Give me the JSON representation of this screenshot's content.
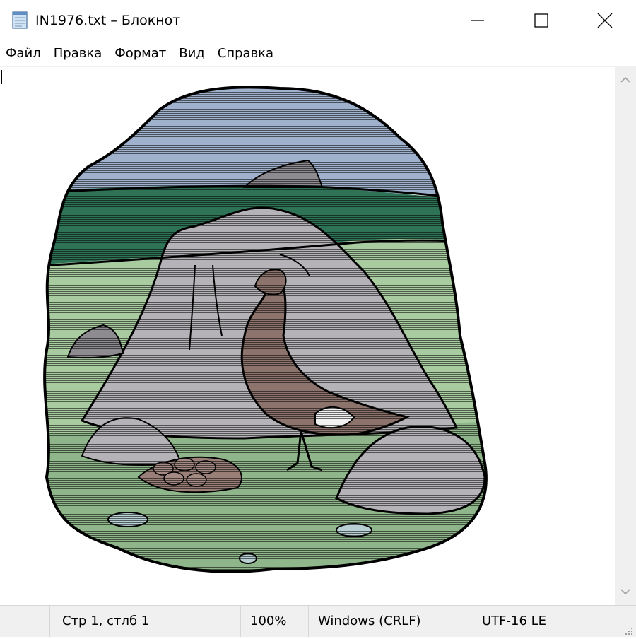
{
  "window": {
    "title": "IN1976.txt – Блокнот",
    "controls": {
      "minimize": "minimize-icon",
      "maximize": "maximize-icon",
      "close": "close-icon"
    }
  },
  "menu": {
    "items": [
      "Файл",
      "Правка",
      "Формат",
      "Вид",
      "Справка"
    ]
  },
  "editor": {
    "content": "ASCII-art illustration: a grouse beside a large boulder with a nest of eggs",
    "scrollbar": {
      "up": "chevron-up-icon",
      "down": "chevron-down-icon"
    }
  },
  "status": {
    "position": "Стр 1, стлб 1",
    "zoom": "100%",
    "line_endings": "Windows (CRLF)",
    "encoding": "UTF-16 LE"
  },
  "colors": {
    "sky": "#9fb1cc",
    "hills": "#2f7357",
    "grass": "#a8cca0",
    "rock": "#b6b3b8",
    "bird": "#8c746c",
    "water": "#b8d0d4"
  }
}
